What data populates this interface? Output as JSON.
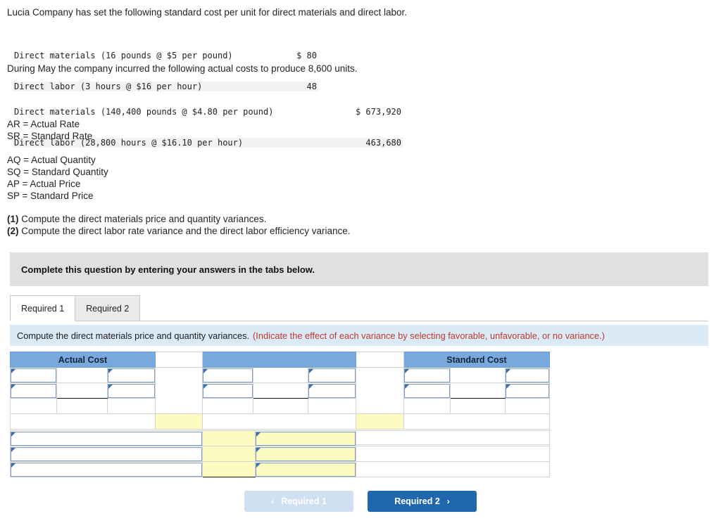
{
  "intro": {
    "line1": "Lucia Company has set the following standard cost per unit for direct materials and direct labor.",
    "during_line": "During May the company incurred the following actual costs to produce 8,600 units."
  },
  "standard_cost_block": {
    "rows": [
      {
        "label": "Direct materials (16 pounds @ $5 per pound)",
        "amount": "$ 80"
      },
      {
        "label": "Direct labor (3 hours @ $16 per hour)",
        "amount": "48"
      }
    ]
  },
  "actual_cost_block": {
    "rows": [
      {
        "label": "Direct materials (140,400 pounds @ $4.80 per pound)",
        "amount": "$ 673,920"
      },
      {
        "label": "Direct labor (28,800 hours @ $16.10 per hour)",
        "amount": "463,680"
      }
    ]
  },
  "definitions": {
    "group1": [
      "AR = Actual Rate",
      "SR = Standard Rate"
    ],
    "group2": [
      "AQ = Actual Quantity",
      "SQ = Standard Quantity",
      "AP = Actual Price",
      "SP = Standard Price"
    ]
  },
  "requirements": [
    {
      "num": "(1)",
      "text": " Compute the direct materials price and quantity variances."
    },
    {
      "num": "(2)",
      "text": " Compute the direct labor rate variance and the direct labor efficiency variance."
    }
  ],
  "instruction_banner": {
    "text": "Complete this question by entering your answers in the tabs below."
  },
  "tabs": [
    {
      "label": "Required 1",
      "active": true
    },
    {
      "label": "Required 2",
      "active": false
    }
  ],
  "task_banner": {
    "main": "Compute the direct materials price and quantity variances.",
    "hint": "(Indicate the effect of each variance by selecting favorable, unfavorable, or no variance.)"
  },
  "worksheet": {
    "headers": {
      "actual_cost": "Actual Cost",
      "middle": "",
      "standard_cost": "Standard Cost"
    },
    "upper_rows": 2,
    "lower_rows": 3
  },
  "nav": {
    "prev_label": "Required 1",
    "next_label": "Required 2",
    "prev_icon": "chevron-left-icon",
    "next_icon": "chevron-right-icon",
    "prev_chevron": "‹",
    "next_chevron": "›"
  },
  "colors": {
    "header_blue": "#79a9dc",
    "banner_blue": "#dbeaf7",
    "hint_red": "#c0392b",
    "highlight_yellow": "#fdfbbf",
    "primary_button": "#2167ae",
    "disabled_button": "#cfe0f0",
    "instruction_gray": "#e0e0e0"
  }
}
